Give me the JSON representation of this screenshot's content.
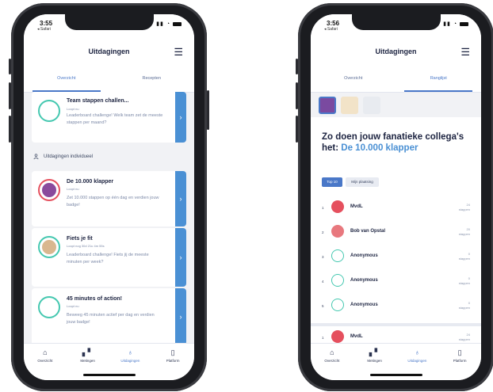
{
  "left": {
    "status": {
      "time": "3:55",
      "back": "◂ Safari"
    },
    "nav_title": "Uitdagingen",
    "tabs": [
      "Overzicht",
      "Recepten"
    ],
    "cards_top": [
      {
        "title": "Team stappen challen...",
        "sub": "Loopt nu",
        "desc": "Leaderboard challenge! Welk team zet de meeste stappen per maand?"
      }
    ],
    "section_label": "Uitdagingen individueel",
    "cards": [
      {
        "title": "De 10.000 klapper",
        "sub": "Loopt nu",
        "desc": "Zet 10.000 stappen op één dag en verdien jouw badge!"
      },
      {
        "title": "Fiets je fit",
        "sub": "Loopt nog 30d 21u 4m 55s",
        "desc": "Leaderboard challenge! Fiets jij de meeste minuten per week?"
      },
      {
        "title": "45 minutes of action!",
        "sub": "Loopt nu",
        "desc": "Beweeg 45 minuten actief per dag en verdien jouw badge!"
      }
    ],
    "bottom_nav": [
      "Overzicht",
      "Metingen",
      "Uitdagingen",
      "Platform"
    ]
  },
  "right": {
    "status": {
      "time": "3:56",
      "back": "◂ Safari"
    },
    "nav_title": "Uitdagingen",
    "tabs": [
      "Overzicht",
      "Ranglijst"
    ],
    "headline_a": "Zo doen jouw fanatieke collega's het: ",
    "headline_b": "De 10.000 klapper",
    "segments": [
      "Top 10",
      "Mijn plaatsing"
    ],
    "rows": [
      {
        "rank": "1",
        "name": "MvdL",
        "score": "24",
        "unit": "stappen"
      },
      {
        "rank": "2",
        "name": "Bob van Opstal",
        "score": "20",
        "unit": "stappen"
      },
      {
        "rank": "3",
        "name": "Anonymous",
        "score": "0",
        "unit": "stappen"
      },
      {
        "rank": "4",
        "name": "Anonymous",
        "score": "0",
        "unit": "stappen"
      },
      {
        "rank": "5",
        "name": "Anonymous",
        "score": "0",
        "unit": "stappen"
      }
    ],
    "me": {
      "rank": "1",
      "name": "MvdL",
      "score": "24",
      "unit": "stappen"
    },
    "bottom_nav": [
      "Overzicht",
      "Metingen",
      "Uitdagingen",
      "Platform"
    ]
  },
  "colors": {
    "accent": "#4a78c8",
    "arrow": "#4a90d4",
    "ring_teal": "#45c8b0",
    "ring_red": "#e5505e",
    "text_dark": "#1c2340"
  }
}
